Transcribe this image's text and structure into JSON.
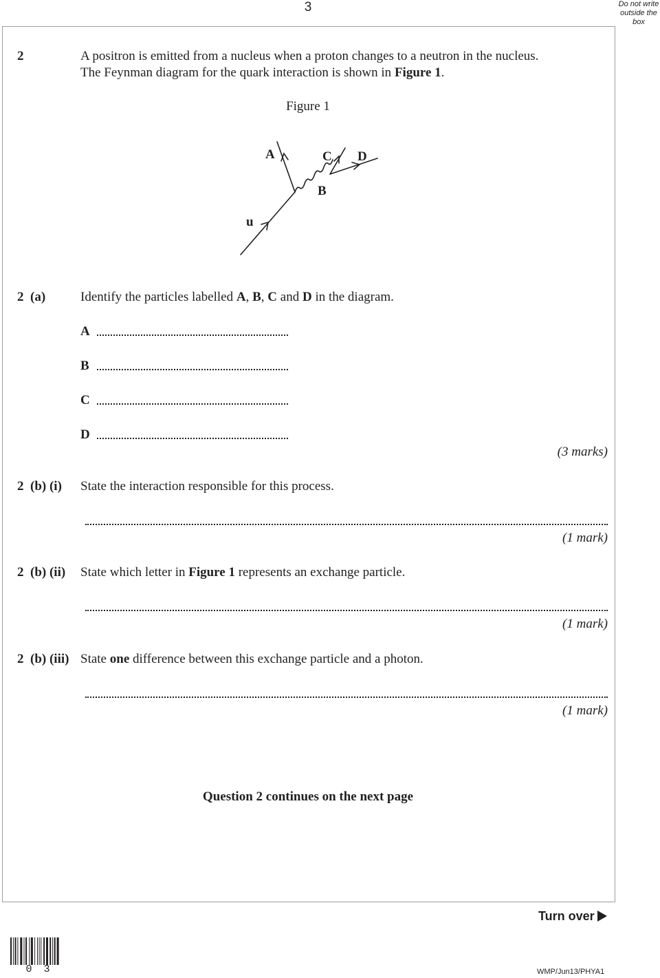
{
  "header": {
    "page_number": "3",
    "margin_note": [
      "Do not write",
      "outside the",
      "box"
    ]
  },
  "question": {
    "number": "2",
    "intro_line1": "A positron is emitted from a nucleus when a proton changes to a neutron in the nucleus.",
    "intro_line2_pre": "The Feynman diagram for the quark interaction is shown in ",
    "intro_line2_bold": "Figure 1",
    "intro_line2_post": "."
  },
  "figure": {
    "title": "Figure 1",
    "labels": {
      "A": "A",
      "B": "B",
      "C": "C",
      "D": "D",
      "u": "u"
    }
  },
  "part_a": {
    "number": "2",
    "sub": "(a)",
    "text_pre": "Identify the particles labelled ",
    "bold_A": "A",
    "sep1": ", ",
    "bold_B": "B",
    "sep2": ", ",
    "bold_C": "C",
    "sep3": " and ",
    "bold_D": "D",
    "text_post": " in the diagram.",
    "answers": [
      {
        "label": "A",
        "value": ""
      },
      {
        "label": "B",
        "value": ""
      },
      {
        "label": "C",
        "value": ""
      },
      {
        "label": "D",
        "value": ""
      }
    ],
    "marks": "(3 marks)"
  },
  "part_b_i": {
    "number": "2",
    "sub": "(b) (i)",
    "text": "State the interaction responsible for this process.",
    "answer": "",
    "marks": "(1 mark)"
  },
  "part_b_ii": {
    "number": "2",
    "sub": "(b) (ii)",
    "text_pre": "State which letter in ",
    "text_bold": "Figure 1",
    "text_post": " represents an exchange particle.",
    "answer": "",
    "marks": "(1 mark)"
  },
  "part_b_iii": {
    "number": "2",
    "sub": "(b) (iii)",
    "text_pre": "State ",
    "text_bold": "one",
    "text_post": " difference between this exchange particle and a photon.",
    "answer": "",
    "marks": "(1 mark)"
  },
  "footer": {
    "continues": "Question 2 continues on the next page",
    "turn_over": "Turn over",
    "barcode_number": "0 3",
    "reference": "WMP/Jun13/PHYA1"
  }
}
